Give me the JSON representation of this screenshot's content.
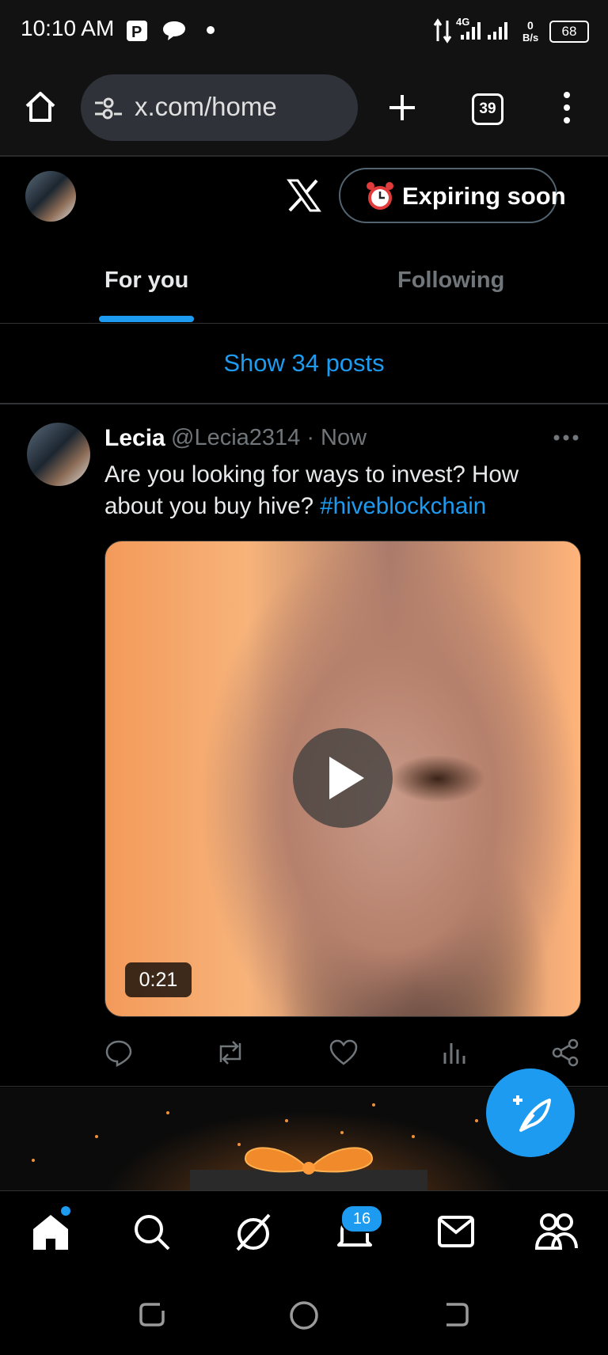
{
  "status_bar": {
    "time": "10:10 AM",
    "network": "4G",
    "speed_value": "0",
    "speed_unit": "B/s",
    "battery": "68"
  },
  "browser": {
    "url": "x.com/home",
    "tab_count": "39"
  },
  "header": {
    "expiring_label": "Expiring soon"
  },
  "tabs": [
    {
      "label": "For you",
      "active": true
    },
    {
      "label": "Following",
      "active": false
    }
  ],
  "show_posts": "Show 34 posts",
  "tweet": {
    "name": "Lecia",
    "handle": "@Lecia2314 · Now",
    "text": "Are you looking for ways to invest? How about you buy hive? ",
    "hashtag": "#hiveblockchain",
    "video_duration": "0:21"
  },
  "notifications_badge": "16",
  "colors": {
    "accent": "#1d9bf0",
    "background": "#000000",
    "secondary_text": "#71767b"
  }
}
